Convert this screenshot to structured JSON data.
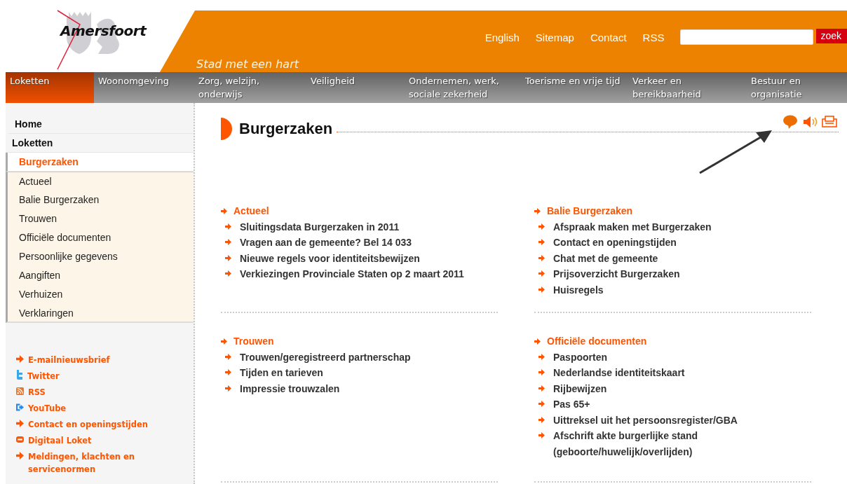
{
  "header": {
    "logo": "Amersfoort",
    "tagline": "Stad met een hart",
    "links": [
      "English",
      "Sitemap",
      "Contact",
      "RSS"
    ],
    "search": {
      "button": "zoek"
    }
  },
  "nav": [
    {
      "label": "Loketten",
      "selected": true
    },
    {
      "label": "Woonomgeving",
      "selected": false
    },
    {
      "label": "Zorg, welzijn, onderwijs",
      "selected": false
    },
    {
      "label": "Veiligheid",
      "selected": false
    },
    {
      "label": "Ondernemen, werk, sociale zekerheid",
      "selected": false
    },
    {
      "label": "Toerisme en vrije tijd",
      "selected": false
    },
    {
      "label": "Verkeer en bereikbaarheid",
      "selected": false
    },
    {
      "label": "Bestuur en organisatie",
      "selected": false
    }
  ],
  "sidebar": {
    "items": [
      {
        "label": "Home",
        "selected": false
      },
      {
        "label": "Loketten",
        "selected": false,
        "children": [
          {
            "label": "Burgerzaken",
            "selected": true,
            "children": [
              {
                "label": "Actueel",
                "selected": false
              },
              {
                "label": "Balie Burgerzaken",
                "selected": false
              },
              {
                "label": "Trouwen",
                "selected": false
              },
              {
                "label": "Officiële documenten",
                "selected": false
              },
              {
                "label": "Persoonlijke gegevens",
                "selected": false
              },
              {
                "label": "Aangiften",
                "selected": false
              },
              {
                "label": "Verhuizen",
                "selected": false
              },
              {
                "label": "Verklaringen",
                "selected": false
              }
            ]
          }
        ]
      }
    ],
    "links": [
      {
        "kind": "arrow",
        "label": "E-mailnieuwsbrief"
      },
      {
        "kind": "twitter",
        "label": "Twitter"
      },
      {
        "kind": "rss",
        "label": "RSS"
      },
      {
        "kind": "video",
        "label": "YouTube"
      },
      {
        "kind": "arrow",
        "label": "Contact en openingstijden"
      },
      {
        "kind": "desk",
        "label": "Digitaal Loket"
      },
      {
        "kind": "arrow",
        "label": "Meldingen, klachten en servicenormen"
      }
    ]
  },
  "page": {
    "title": "Burgerzaken",
    "sections": [
      {
        "title": "Actueel",
        "items": [
          "Sluitingsdata Burgerzaken in 2011",
          "Vragen aan de gemeente? Bel 14 033",
          "Nieuwe regels voor identiteitsbewijzen",
          "Verkiezingen Provinciale Staten op 2 maart 2011"
        ]
      },
      {
        "title": "Balie Burgerzaken",
        "items": [
          "Afspraak maken met Burgerzaken",
          "Contact en openingstijden",
          "Chat met de gemeente",
          "Prijsoverzicht Burgerzaken",
          "Huisregels"
        ]
      },
      {
        "title": "Trouwen",
        "items": [
          "Trouwen/geregistreerd partnerschap",
          "Tijden en tarieven",
          "Impressie trouwzalen"
        ]
      },
      {
        "title": "Officiële documenten",
        "items": [
          "Paspoorten",
          "Nederlandse identiteitskaart",
          "Rijbewijzen",
          "Pas 65+",
          "Uittreksel uit het persoonsregister/GBA",
          "Afschrift akte burgerlijke stand (geboorte/huwelijk/overlijden)"
        ]
      }
    ]
  }
}
